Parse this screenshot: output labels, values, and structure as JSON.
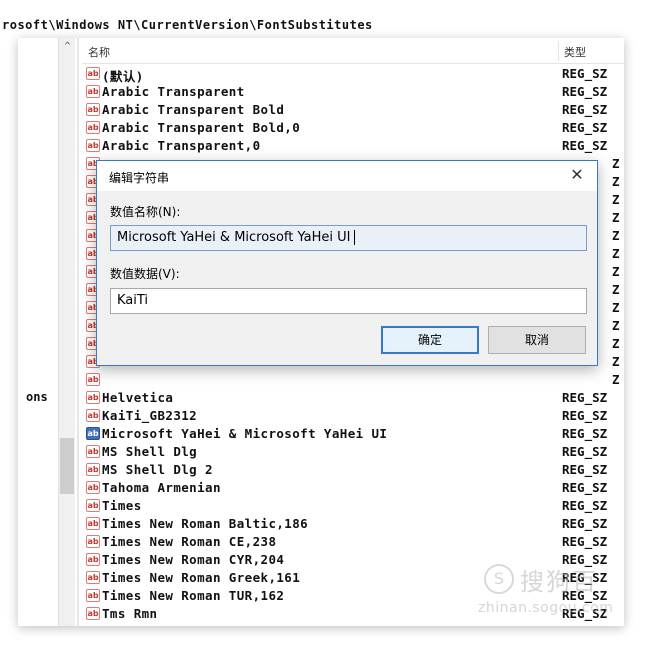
{
  "path_bar": "rosoft\\Windows NT\\CurrentVersion\\FontSubstitutes",
  "tree": {
    "visible_label": "ons",
    "scroll_up_glyph": "^"
  },
  "list": {
    "header_name": "名称",
    "header_type": "类型",
    "rows": [
      {
        "name": "(默认)",
        "type": "REG_SZ"
      },
      {
        "name": "Arabic Transparent",
        "type": "REG_SZ"
      },
      {
        "name": "Arabic Transparent Bold",
        "type": "REG_SZ"
      },
      {
        "name": "Arabic Transparent Bold,0",
        "type": "REG_SZ"
      },
      {
        "name": "Arabic Transparent,0",
        "type": "REG_SZ"
      },
      {
        "name": "",
        "type": ""
      },
      {
        "name": "",
        "type": ""
      },
      {
        "name": "",
        "type": ""
      },
      {
        "name": "",
        "type": ""
      },
      {
        "name": "",
        "type": ""
      },
      {
        "name": "",
        "type": ""
      },
      {
        "name": "",
        "type": ""
      },
      {
        "name": "",
        "type": ""
      },
      {
        "name": "",
        "type": ""
      },
      {
        "name": "",
        "type": ""
      },
      {
        "name": "",
        "type": ""
      },
      {
        "name": "",
        "type": ""
      },
      {
        "name": "",
        "type": ""
      },
      {
        "name": "Helvetica",
        "type": "REG_SZ"
      },
      {
        "name": "KaiTi_GB2312",
        "type": "REG_SZ"
      },
      {
        "name": "Microsoft YaHei & Microsoft YaHei UI",
        "type": "REG_SZ",
        "selected": true
      },
      {
        "name": "MS Shell Dlg",
        "type": "REG_SZ"
      },
      {
        "name": "MS Shell Dlg 2",
        "type": "REG_SZ"
      },
      {
        "name": "Tahoma Armenian",
        "type": "REG_SZ"
      },
      {
        "name": "Times",
        "type": "REG_SZ"
      },
      {
        "name": "Times New Roman Baltic,186",
        "type": "REG_SZ"
      },
      {
        "name": "Times New Roman CE,238",
        "type": "REG_SZ"
      },
      {
        "name": "Times New Roman CYR,204",
        "type": "REG_SZ"
      },
      {
        "name": "Times New Roman Greek,161",
        "type": "REG_SZ"
      },
      {
        "name": "Times New Roman TUR,162",
        "type": "REG_SZ"
      },
      {
        "name": "Tms Rmn",
        "type": "REG_SZ"
      }
    ],
    "hidden_type_tail": "Z",
    "icon_text": "ab"
  },
  "dialog": {
    "title": "编辑字符串",
    "close_glyph": "✕",
    "name_label": "数值名称(N):",
    "name_value": "Microsoft YaHei & Microsoft YaHei UI",
    "data_label": "数值数据(V):",
    "data_value": "KaiTi",
    "ok_label": "确定",
    "cancel_label": "取消"
  },
  "watermark": {
    "logo_glyph": "S",
    "brand": "搜狗百",
    "url": "zhinan.sogou.com"
  }
}
